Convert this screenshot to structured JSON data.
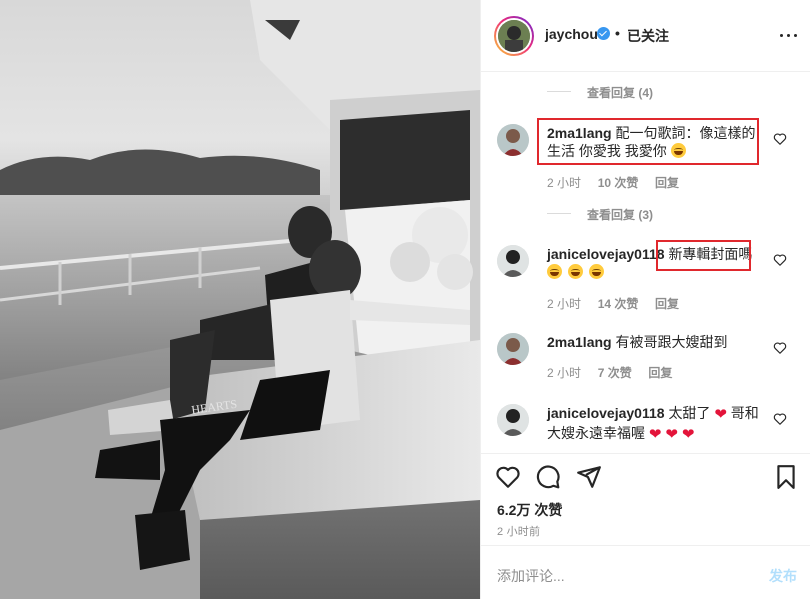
{
  "header": {
    "username": "jaychou",
    "separator": "•",
    "follow_label": "已关注"
  },
  "comments": {
    "view_replies_1": "查看回复 (4)",
    "view_replies_2": "查看回复 (3)",
    "items": [
      {
        "username": "2ma1lang",
        "text": "配一句歌詞：像這樣的生活 你愛我 我愛你",
        "time": "2 小时",
        "likes": "10 次赞",
        "reply": "回复"
      },
      {
        "username": "janicelovejay0118",
        "text": "新專輯封面嗎",
        "time": "2 小时",
        "likes": "14 次赞",
        "reply": "回复"
      },
      {
        "username": "2ma1lang",
        "text": "有被哥跟大嫂甜到",
        "time": "2 小时",
        "likes": "7 次赞",
        "reply": "回复"
      },
      {
        "username": "janicelovejay0118",
        "text_a": "太甜了",
        "text_b": "哥和大嫂永遠幸福喔"
      }
    ]
  },
  "actions": {
    "likes": "6.2万 次赞",
    "time": "2 小时前"
  },
  "add_comment": {
    "placeholder": "添加评论...",
    "post_label": "发布"
  },
  "photo": {
    "hoodie_print": "HEARTS"
  },
  "colors": {
    "highlight": "#e0282d",
    "link_blue": "#3897f0",
    "post_disabled": "#b2dffc"
  }
}
